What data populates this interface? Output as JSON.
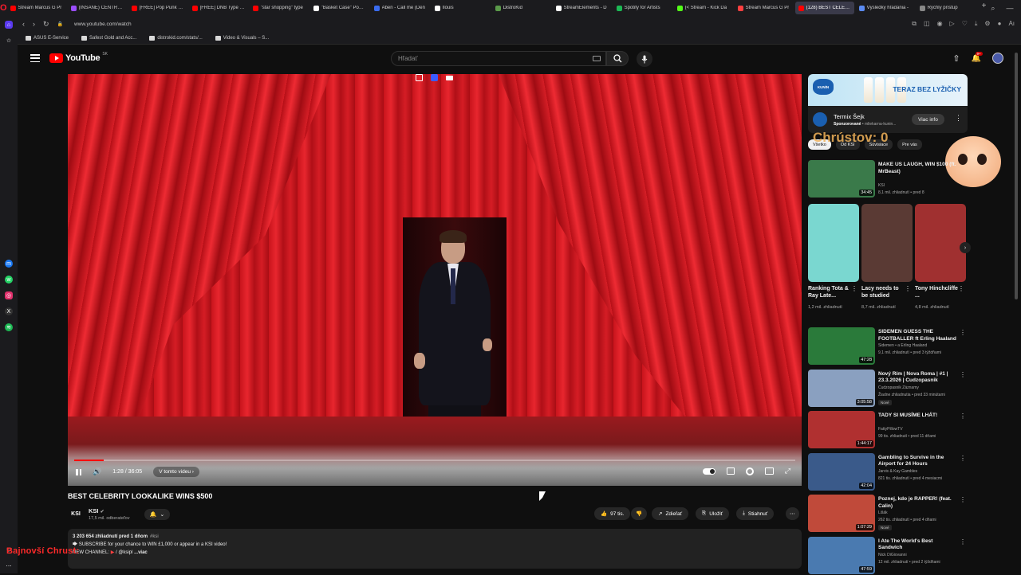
{
  "browser": {
    "tabs": [
      {
        "label": "Stream Marcus G Pr",
        "color": "#ff0000"
      },
      {
        "label": "(INSANE) CENTRAL C",
        "color": "#9b4dff"
      },
      {
        "label": "[FREE] Pop Punk x P",
        "color": "#ff0000"
      },
      {
        "label": "[FREE] DNB Type Be",
        "color": "#ff0000"
      },
      {
        "label": "\"star shopping\" type",
        "color": "#ff0000"
      },
      {
        "label": "\"Basket Case\" Pop P",
        "color": "#ffffff"
      },
      {
        "label": "Aben - Call me (Den",
        "color": "#3a6cf0"
      },
      {
        "label": "Ilouis",
        "color": "#ffffff"
      },
      {
        "label": "DistroKid",
        "color": "#5a9a4a"
      },
      {
        "label": "StreamElements - D",
        "color": "#ffffff"
      },
      {
        "label": "Spotify for Artists",
        "color": "#1db954"
      },
      {
        "label": "(< Stream - Kick Da",
        "color": "#53fc18"
      },
      {
        "label": "Stream Marcus G Pr",
        "color": "#ff4040"
      },
      {
        "label": "(128) BEST CELEBRITY",
        "color": "#ff0000",
        "active": true
      },
      {
        "label": "Výsledky hľadania -",
        "color": "#5a8af0"
      },
      {
        "label": "Rýchly prístup",
        "color": "#888888"
      }
    ],
    "url": "www.youtube.com/watch",
    "bookmarks": [
      "ASUS E-Service",
      "Safest Gold and Acc...",
      "distrokid.com/stats/...",
      "Video & Visuals – S..."
    ]
  },
  "youtube": {
    "logo_text": "YouTube",
    "country_code": "SK",
    "search_placeholder": "Hľadať",
    "notification_count": "9+"
  },
  "player": {
    "time_display": "1:28 / 36:05",
    "chapter_label": "V tomto videu",
    "progress": 0.041
  },
  "video": {
    "title": "BEST CELEBRITY LOOKALIKE WINS $500",
    "channel_logo": "KSI",
    "channel_name": "KSI",
    "subscribers": "17,5 mil. odberateľov",
    "likes": "97 tis.",
    "share_label": "Zdieľať",
    "save_label": "Uložiť",
    "download_label": "Stiahnuť",
    "desc_stats": "3 203 654 zhliadnutí  pred 1 dňom",
    "desc_tag": "#ksi",
    "desc_line2": "SUBSCRIBE for your chance to WIN £1,000 or appear in a KSI video!",
    "desc_line3_prefix": "NEW CHANNEL:",
    "desc_line3_handle": "/ @ksipl",
    "desc_more": "...viac"
  },
  "overlay": {
    "name_text": "Bajnovší Chrust:",
    "score_text": "Chrústov: 0"
  },
  "ad": {
    "brand_logo": "KUNÍN",
    "slogan": "TERAZ BEZ LYŽIČKY",
    "advertiser": "Termix Šejk",
    "sponsored": "Sponzorované",
    "domain": "mliekarna-kunin...",
    "button": "Viac info"
  },
  "chips": [
    "Všetko",
    "Od KSI",
    "Súvisiace",
    "Pre vás"
  ],
  "recommendations_top": [
    {
      "title": "MAKE US LAUGH, WIN $100 (ft. MrBeast)",
      "channel": "KSI",
      "meta": "8,1 mil. zhliadnutí • pred 8",
      "duration": "34:45",
      "thumb": "#3a7a4a"
    }
  ],
  "shorts": [
    {
      "title": "Ranking Tota & Ray Late...",
      "views": "1,2 mil. zhliadnutí",
      "color": "#7ad7d0"
    },
    {
      "title": "Lacy needs to be studied",
      "views": "8,7 mil. zhliadnutí",
      "color": "#5a3a34"
    },
    {
      "title": "Tony Hinchcliffe ...",
      "views": "4,8 mil. zhliadnutí",
      "color": "#a03030"
    }
  ],
  "recommendations": [
    {
      "title": "SIDEMEN GUESS THE FOOTBALLER ft Erling Haaland",
      "channel": "Sidemen • a Erling Haaland",
      "meta": "9,1 mil. zhliadnutí • pred 3 týždňami",
      "duration": "47:28",
      "thumb": "#2a7a3a",
      "badge": ""
    },
    {
      "title": "Nový Rím | Nova Roma | #1 | 23.3.2026 | Cudzopasnik",
      "channel": "Cudzopasnik Záznamy",
      "meta": "Žiadne zhliadnutia • pred 33 minútami",
      "duration": "3:05:58",
      "thumb": "#8aa0c0",
      "badge": "Nové"
    },
    {
      "title": "TADY SI MUSÍME LHÁT!",
      "channel": "FattyPillowTV",
      "meta": "99 tis. zhliadnutí • pred 11 dňami",
      "duration": "1:44:17",
      "thumb": "#b03030",
      "badge": ""
    },
    {
      "title": "Gambling to Survive in the Airport for 24 Hours",
      "channel": "Jarvis & Kay Gambles",
      "meta": "821 tis. zhliadnutí • pred 4 mesiacmi",
      "duration": "42:04",
      "thumb": "#3a5a8a",
      "badge": ""
    },
    {
      "title": "Poznej, kdo je RAPPER! (feat. Calin)",
      "channel": "Lišák",
      "meta": "262 tis. zhliadnutí • pred 4 dňami",
      "duration": "1:07:29",
      "thumb": "#c04a3a",
      "badge": "Nové"
    },
    {
      "title": "I Ate The World's Best Sandwich",
      "channel": "Nick DiGiovanni",
      "meta": "12 mil. zhliadnutí • pred 2 týždňami",
      "duration": "47:59",
      "thumb": "#4a7ab0",
      "badge": ""
    }
  ]
}
